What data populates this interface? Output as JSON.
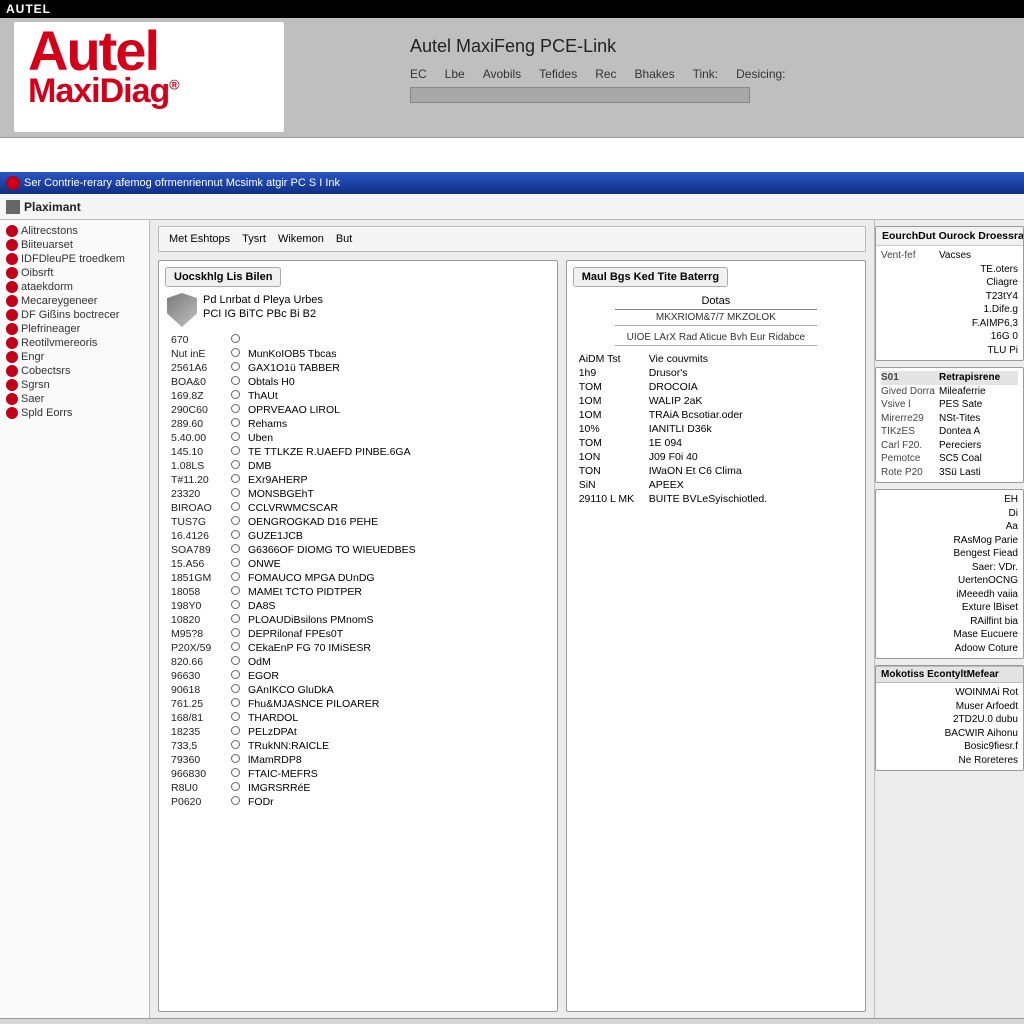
{
  "topbar_text": "AUTEL",
  "logo": {
    "line1": "Autel",
    "line2": "MaxiDiag",
    "reg": "®"
  },
  "app_title": "Autel MaxiFeng PCE-Link",
  "menu": [
    "EC",
    "Lbe",
    "Avobils",
    "Tefides",
    "Rec",
    "Bhakes",
    "Tink:",
    "Desicing:"
  ],
  "bluebar_text": "Ser Contrie-rerary afemog ofrmenriennut Mcsimk atgir PC S I Ink",
  "subheader_text": "Plaximant",
  "sidebar": [
    "Alitrecstons",
    "Biiteuarset",
    "IDFDleuPE troedkem",
    "Oibsrft",
    "ataekdorm",
    "Mecareygeneer",
    "DF Gißins boctrecer",
    "Plefrineager",
    "Reotilvmereoris",
    "Engr",
    "Cobectsrs",
    "Sgrsn",
    "Saer",
    "Spld Eorrs"
  ],
  "tabs": [
    "Met Eshtops",
    "Tysrt",
    "Wikemon",
    "But"
  ],
  "panel_left": {
    "header": "Uocskhlg Lis Bilen",
    "toprow_line1": "Pd Lnrbat d Pleya Urbes",
    "toprow_line2": "PCI IG BiTC PBc Bi B2",
    "rows": [
      [
        "670",
        "",
        ""
      ],
      [
        "Nut inE",
        "",
        "MunKoIOB5 Tbcas"
      ],
      [
        "2561A6",
        "",
        "GAX1O1ü TABBER"
      ],
      [
        "BOA&0",
        "",
        "Obtals H0"
      ],
      [
        "169.8Z",
        "",
        "ThAUt"
      ],
      [
        "290C60",
        "",
        "OPRVEAAO LIROL"
      ],
      [
        "289.60",
        "",
        "Rehams"
      ],
      [
        "5.40.00",
        "",
        "Uben"
      ],
      [
        "145.10",
        "",
        "TE TTLKZE R.UAEFD PINBE.6GA"
      ],
      [
        "1.08LS",
        "",
        "DMB"
      ],
      [
        "T#11.20",
        "",
        "EXr9AHERP"
      ],
      [
        "23320",
        "",
        "MONSBGEhT"
      ],
      [
        "BIROAO",
        "",
        "CCLVRWMCSCAR"
      ],
      [
        "TUS7G",
        "",
        "OENGROGKAD D16 PEHE"
      ],
      [
        "16.4126",
        "",
        "GUZE1JCB"
      ],
      [
        "SOA789",
        "",
        "G6366OF DIOMG TO WIEUEDBES"
      ],
      [
        "15.A56",
        "",
        "ONWE"
      ],
      [
        "1851GM",
        "",
        "FOMAUCO MPGA DUnDG"
      ],
      [
        "18058",
        "",
        "MAMEt TCTO PIDTPER"
      ],
      [
        "198Y0",
        "",
        "DA8S"
      ],
      [
        "10820",
        "",
        "PLOAUDiBsilons PMnomS"
      ],
      [
        "M95?8",
        "",
        "DEPRilonaf FPEs0T"
      ],
      [
        "P20X/59",
        "",
        "CEkaEnP FG 70 IMiSESR"
      ],
      [
        "820.66",
        "",
        "OdM"
      ],
      [
        "96630",
        "",
        "EGOR"
      ],
      [
        "90618",
        "",
        "GAnIKCO GluDkA"
      ],
      [
        "761.25",
        "",
        "Fhu&MJASNCE PILOARER"
      ],
      [
        "168/81",
        "",
        "THARDOL"
      ],
      [
        "18235",
        "",
        "PELzDPAt"
      ],
      [
        "733,5",
        "",
        "TRukNN:RAICLE"
      ],
      [
        "79360",
        "",
        "lMamRDP8"
      ],
      [
        "966830",
        "",
        "FTAIC-MEFRS"
      ],
      [
        "R8U0",
        "",
        "IMGRSRRéE"
      ],
      [
        "P0620",
        "",
        "FODr"
      ]
    ]
  },
  "panel_mid": {
    "header": "Maul Bgs Ked  Tite Baterrg",
    "data_label": "Dotas",
    "subline1": "MKXRIOM&7/7 MKZOLOK",
    "subline2": "UIOE LArX Rad Aticue Bvh Eur Ridabce",
    "rows": [
      [
        "AiDM Tst",
        "Vie couvmits"
      ],
      [
        "1h9",
        "Drusor's"
      ],
      [
        "TOM",
        "DROCOIA"
      ],
      [
        "1OM",
        "WALIP 2aK"
      ],
      [
        "1OM",
        "TRAiA Bcsotiar.oder"
      ],
      [
        "10%",
        "IANITLI D36k"
      ],
      [
        "TOM",
        "1E 094"
      ],
      [
        "1ON",
        "J09 F0i 40"
      ],
      [
        "TON",
        "IWaON Et C6 Clima"
      ],
      [
        "SiN",
        "APEEX"
      ],
      [
        "29110 L MK",
        "BUITE BVLeSyischiotled."
      ]
    ]
  },
  "right": {
    "panel1": {
      "header": "EourchDut Ourock Droessrack",
      "cols": [
        "Vent-fef",
        "Vacses"
      ],
      "rows": [
        "TE.oters",
        "Cliagre",
        "T23tY4",
        "1.Dife.g",
        "F.AIMP6,3",
        "16G 0",
        "TLU Pi"
      ]
    },
    "panel2": {
      "hcols": [
        "S01",
        "Retrapisrene"
      ],
      "rows": [
        [
          "Gived Dorra",
          "Mileaferrie"
        ],
        [
          "Vsive l",
          "PES Sate"
        ],
        [
          "Mirerre29",
          "NSt-Tites"
        ],
        [
          "TIKzES",
          "Dontea A"
        ],
        [
          "Carl F20.",
          "Pereciers"
        ],
        [
          "Pemotce",
          "SC5 Coal"
        ],
        [
          "Rote P20",
          "3Sü Lasti"
        ]
      ]
    },
    "panel3_rows": [
      "EH",
      "Di",
      "Aa",
      "RAsMog Parie",
      "Bengest Fiead",
      "Saer:   VDr.",
      "UertenOCNG",
      "iMeeedh vaiia",
      "Exture lBiset",
      "RAilfint bia",
      "Mase Eucuere",
      "Adoow Coture"
    ],
    "panel4_header": "Mokotiss EcontyltMefear",
    "panel4_rows": [
      "WOINMAi Rot",
      "Muser Arfoedt",
      "2TD2U.0 dubu",
      "BACWIR Aihonu",
      "Bosic9fiesr.f",
      "Ne Roreteres"
    ]
  }
}
